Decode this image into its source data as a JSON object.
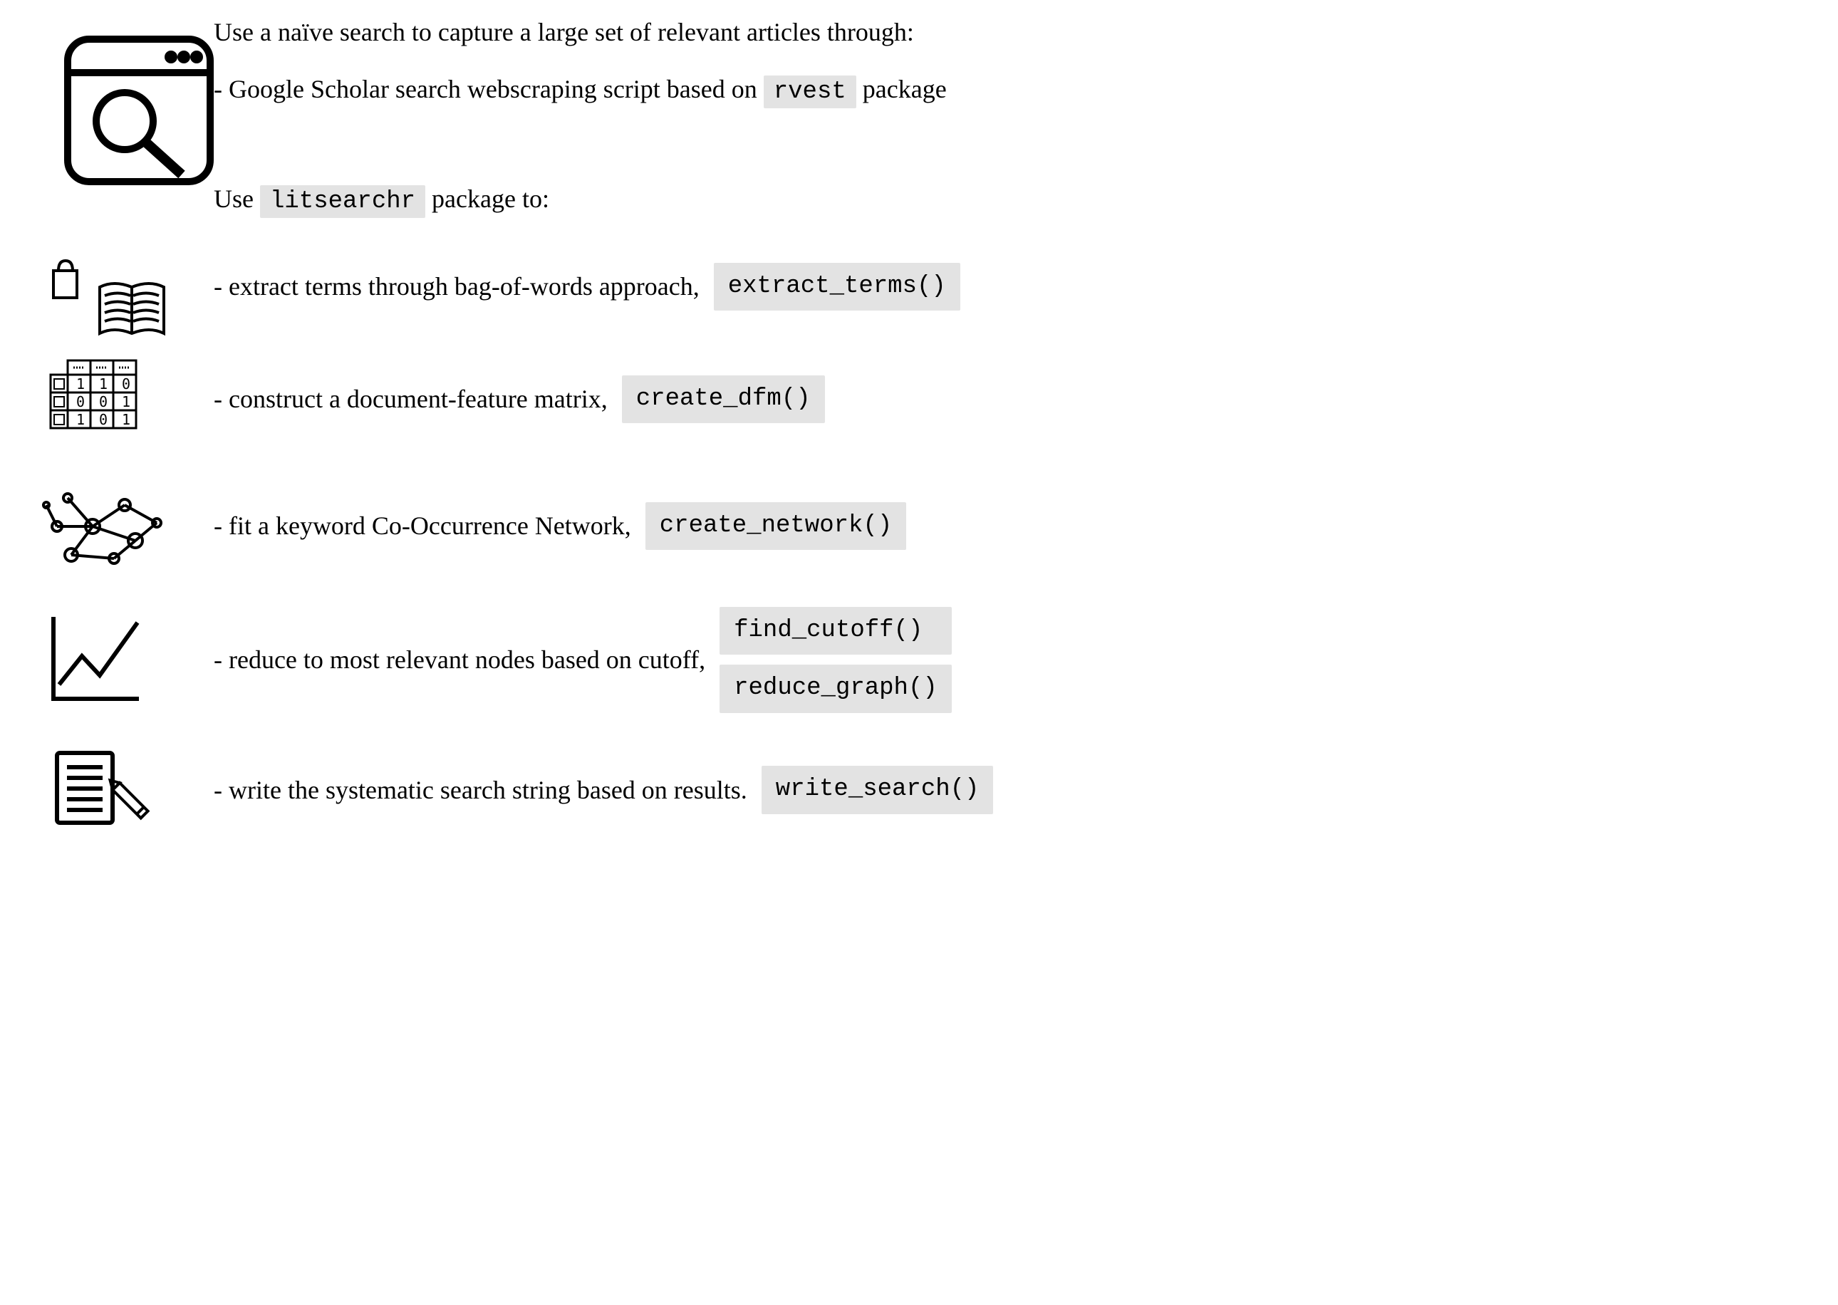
{
  "intro": {
    "title": "Use a naïve search to capture a large set of relevant articles through:",
    "sub_prefix": "- Google Scholar search webscraping script based on ",
    "rvest": "rvest",
    "sub_suffix": " package"
  },
  "use_line": {
    "prefix": "Use ",
    "pkg": "litsearchr",
    "suffix": " package to:"
  },
  "steps": [
    {
      "desc": "- extract terms through bag-of-words approach, ",
      "codes": [
        "extract_terms()"
      ]
    },
    {
      "desc": "- construct a document-feature matrix, ",
      "codes": [
        "create_dfm()"
      ]
    },
    {
      "desc": "- fit a keyword Co-Occurrence Network, ",
      "codes": [
        "create_network()"
      ]
    },
    {
      "desc": "- reduce to most relevant nodes based on cutoff, ",
      "codes": [
        "find_cutoff()",
        "reduce_graph()"
      ]
    },
    {
      "desc": "- write the systematic search string based on results. ",
      "codes": [
        "write_search()"
      ]
    }
  ]
}
